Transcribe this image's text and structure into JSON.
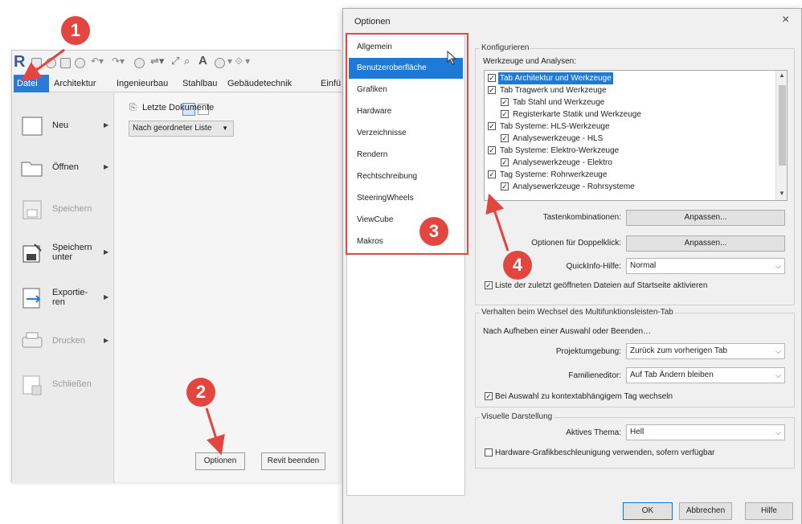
{
  "revit": {
    "app_logo": "R",
    "tabs": [
      "Datei",
      "Architektur",
      "Ingenieurbau",
      "Stahlbau",
      "Gebäudetechnik",
      "Einfü"
    ],
    "menu_items": [
      {
        "label": "Neu",
        "icon": "new-document-icon",
        "enabled": true,
        "submenu": true
      },
      {
        "label": "Öffnen",
        "icon": "folder-open-icon",
        "enabled": true,
        "submenu": true
      },
      {
        "label": "Speichern",
        "icon": "save-icon",
        "enabled": false,
        "submenu": false
      },
      {
        "label": "Speichern unter",
        "icon": "save-as-icon",
        "enabled": true,
        "submenu": true
      },
      {
        "label": "Exportie-ren",
        "icon": "export-icon",
        "enabled": true,
        "submenu": true
      },
      {
        "label": "Drucken",
        "icon": "printer-icon",
        "enabled": false,
        "submenu": true
      },
      {
        "label": "Schließen",
        "icon": "close-document-icon",
        "enabled": false,
        "submenu": false
      }
    ],
    "recent_title": "Letzte Dokumente",
    "sort_option": "Nach geordneter Liste",
    "options_button": "Optionen",
    "exit_button": "Revit beenden"
  },
  "dialog": {
    "title": "Optionen",
    "close": "×",
    "categories": [
      "Allgemein",
      "Benutzeroberfläche",
      "Grafiken",
      "Hardware",
      "Verzeichnisse",
      "Rendern",
      "Rechtschreibung",
      "SteeringWheels",
      "ViewCube",
      "Makros"
    ],
    "selected_category": "Benutzeroberfläche",
    "configure_group": "Konfigurieren",
    "tools_label": "Werkzeuge und Analysen:",
    "tools": [
      {
        "label": "Tab Architektur und Werkzeuge",
        "level": 0,
        "checked": true,
        "highlighted": true
      },
      {
        "label": "Tab Tragwerk und Werkzeuge",
        "level": 0,
        "checked": true
      },
      {
        "label": "Tab Stahl und Werkzeuge",
        "level": 1,
        "checked": true
      },
      {
        "label": "Registerkarte Statik und Werkzeuge",
        "level": 1,
        "checked": true
      },
      {
        "label": "Tab Systeme: HLS-Werkzeuge",
        "level": 0,
        "checked": true
      },
      {
        "label": "Analysewerkzeuge - HLS",
        "level": 1,
        "checked": true
      },
      {
        "label": "Tab Systeme: Elektro-Werkzeuge",
        "level": 0,
        "checked": true
      },
      {
        "label": "Analysewerkzeuge - Elektro",
        "level": 1,
        "checked": true
      },
      {
        "label": "Tag Systeme: Rohrwerkzeuge",
        "level": 0,
        "checked": true
      },
      {
        "label": "Analysewerkzeuge - Rohrsysteme",
        "level": 1,
        "checked": true
      }
    ],
    "shortcuts_label": "Tastenkombinationen:",
    "shortcuts_button": "Anpassen...",
    "dblclick_label": "Optionen für Doppelklick:",
    "dblclick_button": "Anpassen...",
    "tooltip_label": "QuickInfo-Hilfe:",
    "tooltip_value": "Normal",
    "recent_files_checkbox": "Liste der zuletzt geöffneten Dateien auf Startseite aktivieren",
    "tab_switch_group": "Verhalten beim Wechsel des Multifunktionsleisten-Tab",
    "after_clear_label": "Nach Aufheben einer Auswahl oder Beenden…",
    "project_env_label": "Projektumgebung:",
    "project_env_value": "Zurück zum vorherigen Tab",
    "family_editor_label": "Familieneditor:",
    "family_editor_value": "Auf Tab Ändern bleiben",
    "context_tab_checkbox": "Bei Auswahl zu kontextabhängigem Tag wechseln",
    "visual_group": "Visuelle Darstellung",
    "theme_label": "Aktives Thema:",
    "theme_value": "Hell",
    "hw_accel_checkbox": "Hardware-Grafikbeschleunigung verwenden, sofern verfügbar",
    "ok_button": "OK",
    "cancel_button": "Abbrechen",
    "help_button": "Hilfe"
  },
  "annotations": {
    "markers": [
      "1",
      "2",
      "3",
      "4"
    ],
    "color": "#e3463e"
  },
  "colors": {
    "accent_blue": "#1e7ad7",
    "highlight_red": "#e04b45"
  }
}
